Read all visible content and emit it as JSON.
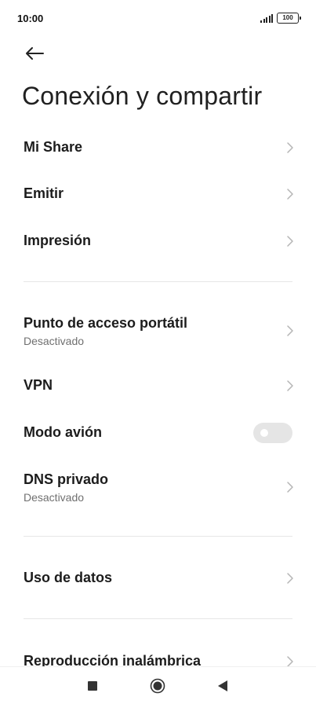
{
  "status_bar": {
    "time": "10:00",
    "battery": "100"
  },
  "header": {
    "title": "Conexión y compartir"
  },
  "items": {
    "mi_share": {
      "title": "Mi Share"
    },
    "emitir": {
      "title": "Emitir"
    },
    "impresion": {
      "title": "Impresión"
    },
    "hotspot": {
      "title": "Punto de acceso portátil",
      "subtitle": "Desactivado"
    },
    "vpn": {
      "title": "VPN"
    },
    "airplane": {
      "title": "Modo avión",
      "enabled": false
    },
    "private_dns": {
      "title": "DNS privado",
      "subtitle": "Desactivado"
    },
    "data_usage": {
      "title": "Uso de datos"
    },
    "wireless_display": {
      "title": "Reproducción inalámbrica"
    }
  },
  "colors": {
    "background": "#ffffff",
    "text": "#1c1c1c",
    "subtext": "#707070",
    "chevron": "#b5b5b5",
    "toggle_off": "#e5e5e5",
    "divider": "#e6e6e6"
  },
  "icons": {
    "back": "arrow-left-icon",
    "chevron": "chevron-right-icon",
    "nav_recents": "square-icon",
    "nav_home": "circle-icon",
    "nav_back": "triangle-left-icon"
  }
}
